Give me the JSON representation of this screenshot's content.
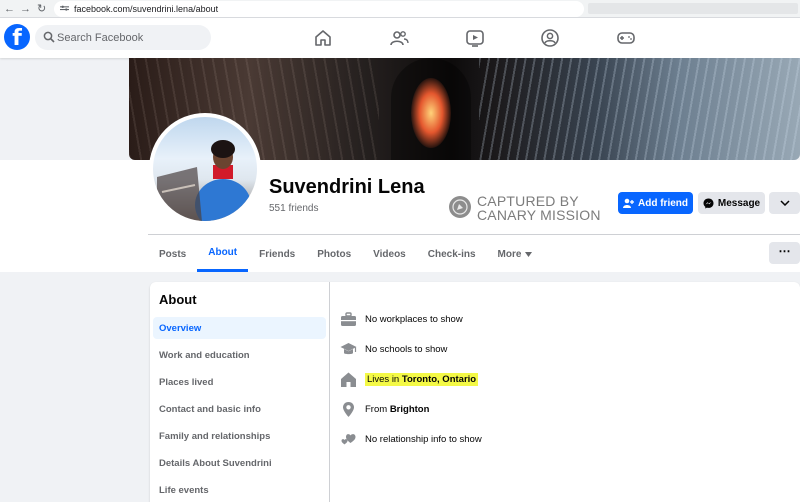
{
  "browser": {
    "url": "facebook.com/suvendrini.lena/about"
  },
  "header": {
    "search_placeholder": "Search Facebook",
    "nav_icons": [
      "home-icon",
      "friends-icon",
      "watch-icon",
      "groups-icon",
      "gaming-icon"
    ]
  },
  "profile": {
    "name": "Suvendrini Lena",
    "friends": "551 friends",
    "add_friend_label": "Add friend",
    "message_label": "Message"
  },
  "watermark": {
    "line1": "CAPTURED BY",
    "line2": "CANARY MISSION"
  },
  "tabs": [
    {
      "label": "Posts"
    },
    {
      "label": "About"
    },
    {
      "label": "Friends"
    },
    {
      "label": "Photos"
    },
    {
      "label": "Videos"
    },
    {
      "label": "Check-ins"
    },
    {
      "label": "More"
    }
  ],
  "about": {
    "title": "About",
    "nav": [
      {
        "label": "Overview"
      },
      {
        "label": "Work and education"
      },
      {
        "label": "Places lived"
      },
      {
        "label": "Contact and basic info"
      },
      {
        "label": "Family and relationships"
      },
      {
        "label": "Details About Suvendrini"
      },
      {
        "label": "Life events"
      }
    ],
    "rows": {
      "work": "No workplaces to show",
      "school": "No schools to show",
      "lives_prefix": "Lives in ",
      "lives_place": "Toronto, Ontario",
      "from_prefix": "From ",
      "from_place": "Brighton",
      "relationship": "No relationship info to show"
    }
  },
  "colors": {
    "brand": "#0866ff",
    "highlight": "#f4f946"
  }
}
